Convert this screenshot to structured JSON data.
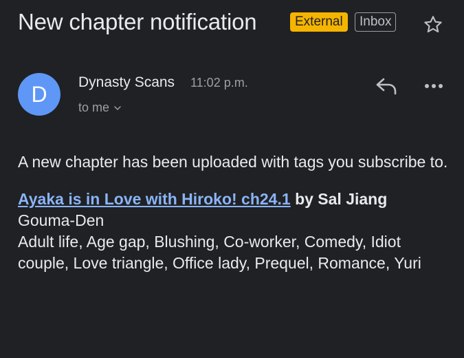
{
  "message": {
    "subject": "New chapter notification",
    "labels": {
      "external": "External",
      "inbox": "Inbox"
    },
    "star_icon": "star-outline-icon",
    "sender": {
      "avatar_letter": "D",
      "avatar_color": "#5e97f6",
      "name": "Dynasty Scans",
      "time": "11:02 p.m.",
      "recipient": "to me"
    },
    "actions": {
      "reply_icon": "reply-icon",
      "more_icon": "more-horizontal-icon"
    },
    "body": {
      "intro": "A new chapter has been uploaded with tags you subscribe to.",
      "chapter_title": "Ayaka is in Love with Hiroko! ch24.1",
      "author": "by Sal Jiang",
      "group": "Gouma-Den",
      "tags": "Adult life, Age gap, Blushing, Co-worker, Comedy, Idiot couple, Love triangle, Office lady, Prequel, Romance, Yuri"
    }
  },
  "colors": {
    "background": "#202124",
    "external_badge": "#f5b400",
    "link": "#8ab4f8",
    "secondary_text": "#9aa0a6"
  }
}
